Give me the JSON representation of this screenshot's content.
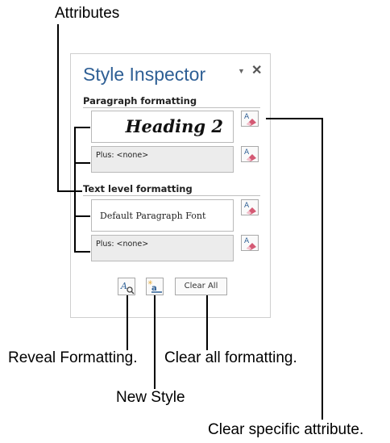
{
  "callouts": {
    "attributes": "Attributes",
    "reveal_formatting": "Reveal Formatting.",
    "clear_all_formatting": "Clear all formatting.",
    "new_style": "New Style",
    "clear_specific_attribute": "Clear specific attribute."
  },
  "panel": {
    "title": "Style Inspector",
    "pin_icon": "dropdown-arrow-icon",
    "close_icon": "close-icon",
    "paragraph_section": {
      "label": "Paragraph formatting",
      "style_box": "Heading 2",
      "plus_box": "Plus: <none>"
    },
    "text_section": {
      "label": "Text level formatting",
      "style_box": "Default Paragraph Font",
      "plus_box": "Plus: <none>"
    },
    "buttons": {
      "clear_all": "Clear All",
      "reveal_icon": "reveal-formatting-icon",
      "new_style_icon": "new-style-icon"
    }
  },
  "colors": {
    "title": "#2e5f95",
    "eraser": "#d45a74"
  }
}
